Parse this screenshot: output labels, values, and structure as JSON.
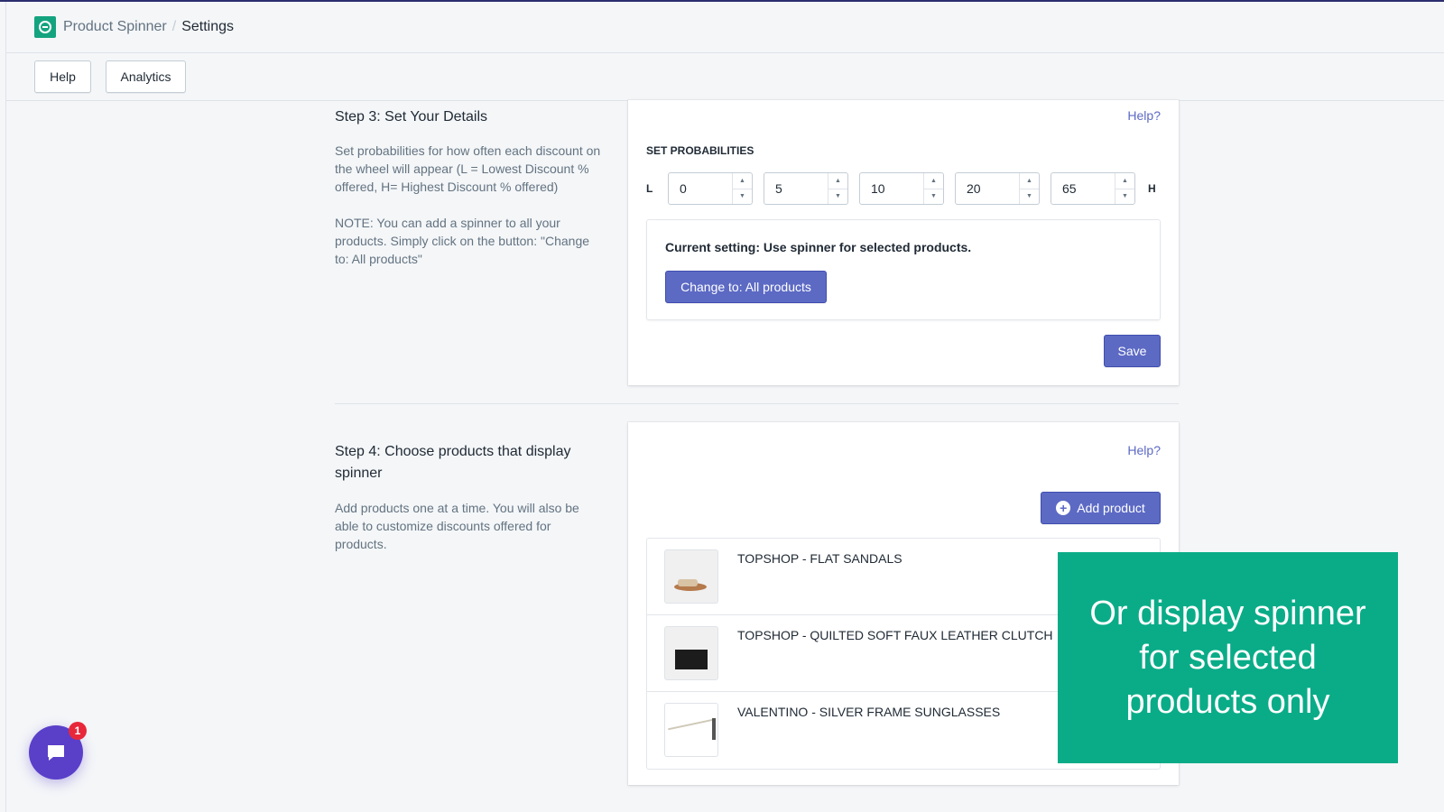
{
  "header": {
    "app_name": "Product Spinner",
    "separator": "/",
    "page": "Settings"
  },
  "nav": {
    "help": "Help",
    "analytics": "Analytics"
  },
  "step3": {
    "title": "Step 3: Set Your Details",
    "desc": "Set probabilities for how often each discount on the wheel will appear (L = Lowest Discount % offered, H= Highest Discount % offered)",
    "note": "NOTE: You can add a spinner to all your products. Simply click on the button: \"Change to: All products\"",
    "help_link": "Help?",
    "probabilities_label": "SET PROBABILITIES",
    "low_label": "L",
    "high_label": "H",
    "probabilities": [
      "0",
      "5",
      "10",
      "20",
      "65"
    ],
    "current_setting": "Current setting: Use spinner for selected products.",
    "change_button": "Change to: All products",
    "save_button": "Save"
  },
  "step4": {
    "title": "Step 4: Choose products that display spinner",
    "desc": "Add products one at a time. You will also be able to customize discounts offered for products.",
    "help_link": "Help?",
    "add_button": "Add product",
    "products": [
      {
        "name": "TOPSHOP - FLAT SANDALS"
      },
      {
        "name": "TOPSHOP - QUILTED SOFT FAUX LEATHER CLUTCH"
      },
      {
        "name": "VALENTINO - SILVER FRAME SUNGLASSES"
      }
    ]
  },
  "overlay": {
    "text": "Or display spinner for selected products only"
  },
  "chat": {
    "badge": "1"
  },
  "colors": {
    "primary": "#5c6ac4",
    "brand": "#14a37f",
    "overlay": "#0aac88",
    "chat": "#5a3fc9"
  }
}
